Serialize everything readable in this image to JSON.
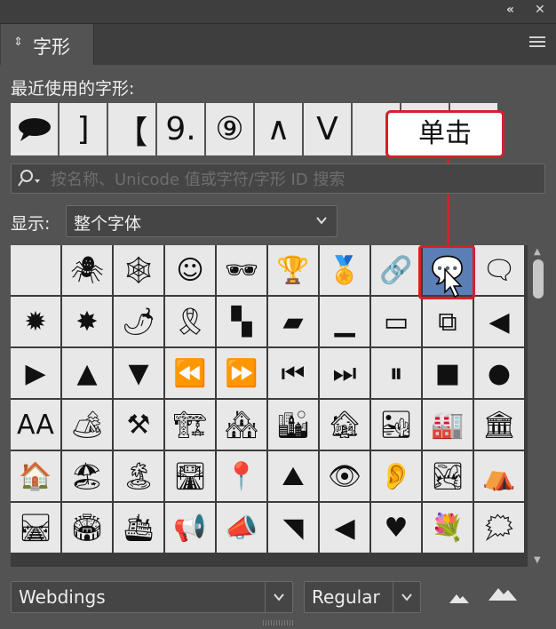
{
  "window": {
    "collapse_icon": "double-chevron-left-icon",
    "close_icon": "close-icon"
  },
  "panel": {
    "tab_title": "字形",
    "menu_icon": "hamburger-menu-icon"
  },
  "recent": {
    "label": "最近使用的字形:",
    "glyphs": [
      "speech-bubble-icon",
      "]",
      "【",
      "9.",
      "⑨",
      "∧",
      "V"
    ]
  },
  "callout": {
    "text": "单击",
    "color": "#d6202a"
  },
  "search": {
    "placeholder": "按名称、Unicode 值或字符/字形 ID 搜索",
    "icon": "search-icon"
  },
  "show": {
    "label": "显示:",
    "value": "整个字体"
  },
  "glyph_grid": {
    "rows": [
      [
        "",
        "🕷",
        "🕸",
        "☺",
        "🕶",
        "🏆",
        "🏅",
        "🔗",
        "💬",
        "🗨"
      ],
      [
        "✹",
        "✸",
        "🌶",
        "🎗",
        "▚",
        "▰",
        "▁",
        "▭",
        "⧉",
        "◀"
      ],
      [
        "▶",
        "▲",
        "▼",
        "⏪",
        "⏩",
        "⏮",
        "⏭",
        "⏸",
        "■",
        "●"
      ],
      [
        "AA",
        "🏕",
        "⚒",
        "🏗",
        "🏘",
        "🏙",
        "🏚",
        "🏜",
        "🏭",
        "🏛"
      ],
      [
        "🏠",
        "🏖",
        "🏝",
        "🛣",
        "📍",
        "⛰",
        "👁",
        "👂",
        "🏞",
        "⛺"
      ],
      [
        "🛤",
        "🏟",
        "🛳",
        "📢",
        "📣",
        "◥",
        "◀",
        "♥",
        "💐",
        "🗯"
      ]
    ],
    "selected": {
      "row": 0,
      "col": 8
    },
    "selected_color": "#5b7fb4"
  },
  "bottom": {
    "font_family": "Webdings",
    "font_style": "Regular",
    "small_glyph_icon": "mountain-small-icon",
    "large_glyph_icon": "mountain-large-icon"
  }
}
